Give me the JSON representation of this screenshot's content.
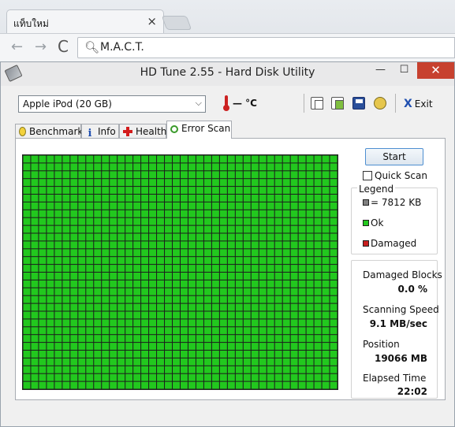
{
  "browser": {
    "tab_title": "แท็บใหม่",
    "tab_close": "×",
    "address": "M.A.C.T.",
    "back": "←",
    "forward": "→",
    "reload": "C",
    "search_icon": "magnifier-icon"
  },
  "window": {
    "title": "HD Tune 2.55 - Hard Disk Utility",
    "minimize": "—",
    "maximize": "☐",
    "close": "✕"
  },
  "toolbar": {
    "device": "Apple   iPod (20 GB)",
    "temperature": "— °C",
    "exit_label": "Exit",
    "exit_icon": "X"
  },
  "tabs": [
    {
      "label": "Benchmark",
      "icon": "lightbulb-icon"
    },
    {
      "label": "Info",
      "icon": "info-icon"
    },
    {
      "label": "Health",
      "icon": "health-cross-icon"
    },
    {
      "label": "Error Scan",
      "icon": "magnifier-icon",
      "active": true
    }
  ],
  "scan": {
    "start_label": "Start",
    "quick_scan_label": "Quick Scan",
    "quick_scan_checked": false,
    "grid": {
      "cols": 40,
      "rows": 30,
      "ok_color": "#22c81e",
      "line_color": "#1c1c1c"
    }
  },
  "legend": {
    "title": "Legend",
    "block_size": "= 7812 KB",
    "ok": "Ok",
    "damaged": "Damaged",
    "colors": {
      "block": "#808080",
      "ok": "#22c81e",
      "damaged": "#c81e1e"
    }
  },
  "stats": {
    "damaged_blocks_label": "Damaged Blocks",
    "damaged_blocks_value": "0.0 %",
    "scanning_speed_label": "Scanning Speed",
    "scanning_speed_value": "9.1 MB/sec",
    "position_label": "Position",
    "position_value": "19066 MB",
    "elapsed_time_label": "Elapsed Time",
    "elapsed_time_value": "22:02"
  }
}
